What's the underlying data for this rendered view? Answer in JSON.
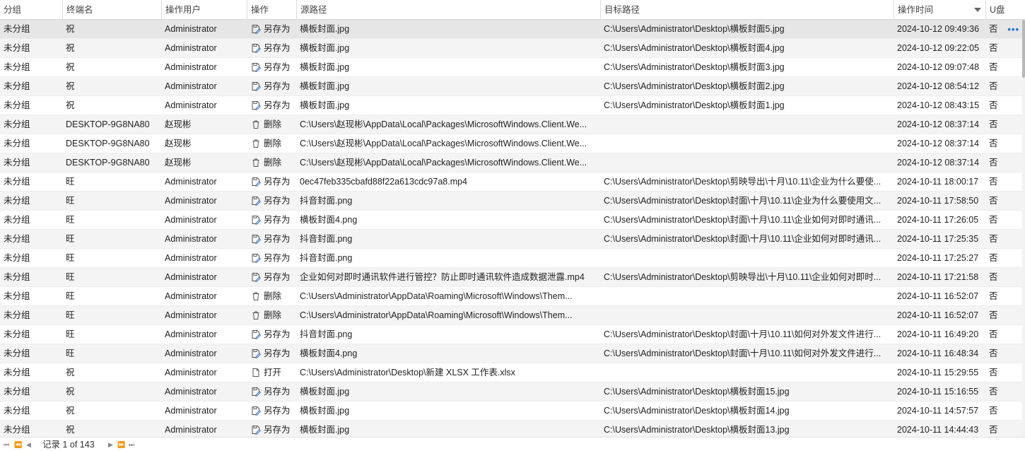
{
  "columns": {
    "group": "分组",
    "terminal": "终端名",
    "user": "操作用户",
    "op": "操作",
    "src": "源路径",
    "dst": "目标路径",
    "time": "操作时间",
    "usb": "U盘"
  },
  "more_label": "•••",
  "footer": {
    "first_label": "⏮",
    "prev_page_label": "⏪",
    "prev_label": "◀",
    "record_text": "记录 1 of 143",
    "next_label": "▶",
    "next_page_label": "⏩",
    "last_label": "⏭"
  },
  "rows": [
    {
      "group": "未分组",
      "terminal": "祝",
      "user": "Administrator",
      "op_icon": "save-as-icon",
      "op": "另存为",
      "src": "横板封面.jpg",
      "dst": "C:\\Users\\Administrator\\Desktop\\横板封面5.jpg",
      "time": "2024-10-12 09:49:36",
      "usb": "否"
    },
    {
      "group": "未分组",
      "terminal": "祝",
      "user": "Administrator",
      "op_icon": "save-as-icon",
      "op": "另存为",
      "src": "横板封面.jpg",
      "dst": "C:\\Users\\Administrator\\Desktop\\横板封面4.jpg",
      "time": "2024-10-12 09:22:05",
      "usb": "否"
    },
    {
      "group": "未分组",
      "terminal": "祝",
      "user": "Administrator",
      "op_icon": "save-as-icon",
      "op": "另存为",
      "src": "横板封面.jpg",
      "dst": "C:\\Users\\Administrator\\Desktop\\横板封面3.jpg",
      "time": "2024-10-12 09:07:48",
      "usb": "否"
    },
    {
      "group": "未分组",
      "terminal": "祝",
      "user": "Administrator",
      "op_icon": "save-as-icon",
      "op": "另存为",
      "src": "横板封面.jpg",
      "dst": "C:\\Users\\Administrator\\Desktop\\横板封面2.jpg",
      "time": "2024-10-12 08:54:12",
      "usb": "否"
    },
    {
      "group": "未分组",
      "terminal": "祝",
      "user": "Administrator",
      "op_icon": "save-as-icon",
      "op": "另存为",
      "src": "横板封面.jpg",
      "dst": "C:\\Users\\Administrator\\Desktop\\横板封面1.jpg",
      "time": "2024-10-12 08:43:15",
      "usb": "否"
    },
    {
      "group": "未分组",
      "terminal": "DESKTOP-9G8NA80",
      "user": "赵现彬",
      "op_icon": "delete-icon",
      "op": "删除",
      "src": "C:\\Users\\赵现彬\\AppData\\Local\\Packages\\MicrosoftWindows.Client.We...",
      "dst": "",
      "time": "2024-10-12 08:37:14",
      "usb": "否"
    },
    {
      "group": "未分组",
      "terminal": "DESKTOP-9G8NA80",
      "user": "赵现彬",
      "op_icon": "delete-icon",
      "op": "删除",
      "src": "C:\\Users\\赵现彬\\AppData\\Local\\Packages\\MicrosoftWindows.Client.We...",
      "dst": "",
      "time": "2024-10-12 08:37:14",
      "usb": "否"
    },
    {
      "group": "未分组",
      "terminal": "DESKTOP-9G8NA80",
      "user": "赵现彬",
      "op_icon": "delete-icon",
      "op": "删除",
      "src": "C:\\Users\\赵现彬\\AppData\\Local\\Packages\\MicrosoftWindows.Client.We...",
      "dst": "",
      "time": "2024-10-12 08:37:14",
      "usb": "否"
    },
    {
      "group": "未分组",
      "terminal": "旺",
      "user": "Administrator",
      "op_icon": "save-as-icon",
      "op": "另存为",
      "src": "0ec47feb335cbafd88f22a613cdc97a8.mp4",
      "dst": "C:\\Users\\Administrator\\Desktop\\剪映导出\\十月\\10.11\\企业为什么要使...",
      "time": "2024-10-11 18:00:17",
      "usb": "否"
    },
    {
      "group": "未分组",
      "terminal": "旺",
      "user": "Administrator",
      "op_icon": "save-as-icon",
      "op": "另存为",
      "src": "抖音封面.png",
      "dst": "C:\\Users\\Administrator\\Desktop\\封面\\十月\\10.11\\企业为什么要使用文...",
      "time": "2024-10-11 17:58:50",
      "usb": "否"
    },
    {
      "group": "未分组",
      "terminal": "旺",
      "user": "Administrator",
      "op_icon": "save-as-icon",
      "op": "另存为",
      "src": "横板封面4.png",
      "dst": "C:\\Users\\Administrator\\Desktop\\封面\\十月\\10.11\\企业如何对即时通讯...",
      "time": "2024-10-11 17:26:05",
      "usb": "否"
    },
    {
      "group": "未分组",
      "terminal": "旺",
      "user": "Administrator",
      "op_icon": "save-as-icon",
      "op": "另存为",
      "src": "抖音封面.png",
      "dst": "C:\\Users\\Administrator\\Desktop\\封面\\十月\\10.11\\企业如何对即时通讯...",
      "time": "2024-10-11 17:25:35",
      "usb": "否"
    },
    {
      "group": "未分组",
      "terminal": "旺",
      "user": "Administrator",
      "op_icon": "save-as-icon",
      "op": "另存为",
      "src": "抖音封面.png",
      "dst": "",
      "time": "2024-10-11 17:25:27",
      "usb": "否"
    },
    {
      "group": "未分组",
      "terminal": "旺",
      "user": "Administrator",
      "op_icon": "save-as-icon",
      "op": "另存为",
      "src": "企业如何对即时通讯软件进行管控？防止即时通讯软件造成数据泄露.mp4",
      "dst": "C:\\Users\\Administrator\\Desktop\\剪映导出\\十月\\10.11\\企业如何对即时...",
      "time": "2024-10-11 17:21:58",
      "usb": "否"
    },
    {
      "group": "未分组",
      "terminal": "旺",
      "user": "Administrator",
      "op_icon": "delete-icon",
      "op": "删除",
      "src": "C:\\Users\\Administrator\\AppData\\Roaming\\Microsoft\\Windows\\Them...",
      "dst": "",
      "time": "2024-10-11 16:52:07",
      "usb": "否"
    },
    {
      "group": "未分组",
      "terminal": "旺",
      "user": "Administrator",
      "op_icon": "delete-icon",
      "op": "删除",
      "src": "C:\\Users\\Administrator\\AppData\\Roaming\\Microsoft\\Windows\\Them...",
      "dst": "",
      "time": "2024-10-11 16:52:07",
      "usb": "否"
    },
    {
      "group": "未分组",
      "terminal": "旺",
      "user": "Administrator",
      "op_icon": "save-as-icon",
      "op": "另存为",
      "src": "抖音封面.png",
      "dst": "C:\\Users\\Administrator\\Desktop\\封面\\十月\\10.11\\如何对外发文件进行...",
      "time": "2024-10-11 16:49:20",
      "usb": "否"
    },
    {
      "group": "未分组",
      "terminal": "旺",
      "user": "Administrator",
      "op_icon": "save-as-icon",
      "op": "另存为",
      "src": "横板封面4.png",
      "dst": "C:\\Users\\Administrator\\Desktop\\封面\\十月\\10.11\\如何对外发文件进行...",
      "time": "2024-10-11 16:48:34",
      "usb": "否"
    },
    {
      "group": "未分组",
      "terminal": "祝",
      "user": "Administrator",
      "op_icon": "open-file-icon",
      "op": "打开",
      "src": "C:\\Users\\Administrator\\Desktop\\新建 XLSX 工作表.xlsx",
      "dst": "",
      "time": "2024-10-11 15:29:55",
      "usb": "否"
    },
    {
      "group": "未分组",
      "terminal": "祝",
      "user": "Administrator",
      "op_icon": "save-as-icon",
      "op": "另存为",
      "src": "横板封面.jpg",
      "dst": "C:\\Users\\Administrator\\Desktop\\横板封面15.jpg",
      "time": "2024-10-11 15:16:55",
      "usb": "否"
    },
    {
      "group": "未分组",
      "terminal": "祝",
      "user": "Administrator",
      "op_icon": "save-as-icon",
      "op": "另存为",
      "src": "横板封面.jpg",
      "dst": "C:\\Users\\Administrator\\Desktop\\横板封面14.jpg",
      "time": "2024-10-11 14:57:57",
      "usb": "否"
    },
    {
      "group": "未分组",
      "terminal": "祝",
      "user": "Administrator",
      "op_icon": "save-as-icon",
      "op": "另存为",
      "src": "横板封面.jpg",
      "dst": "C:\\Users\\Administrator\\Desktop\\横板封面13.jpg",
      "time": "2024-10-11 14:44:43",
      "usb": "否"
    }
  ]
}
